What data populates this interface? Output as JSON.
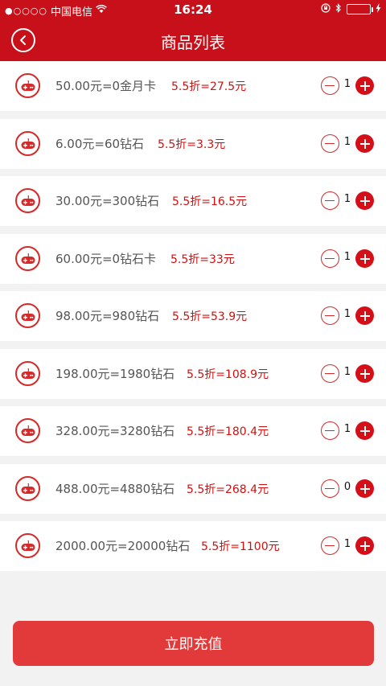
{
  "status_bar": {
    "signal": "●○○○○",
    "carrier": "中国电信",
    "time": "16:24"
  },
  "header": {
    "title": "商品列表"
  },
  "items": [
    {
      "name": "50.00元=0金月卡",
      "price": "5.5折=27.5元",
      "qty": "1"
    },
    {
      "name": "6.00元=60钻石",
      "price": "5.5折=3.3元",
      "qty": "1"
    },
    {
      "name": "30.00元=300钻石",
      "price": "5.5折=16.5元",
      "qty": "1"
    },
    {
      "name": "60.00元=0钻石卡",
      "price": "5.5折=33元",
      "qty": "1"
    },
    {
      "name": "98.00元=980钻石",
      "price": "5.5折=53.9元",
      "qty": "1"
    },
    {
      "name": "198.00元=1980钻石",
      "price": "5.5折=108.9元",
      "qty": "1"
    },
    {
      "name": "328.00元=3280钻石",
      "price": "5.5折=180.4元",
      "qty": "1"
    },
    {
      "name": "488.00元=4880钻石",
      "price": "5.5折=268.4元",
      "qty": "0"
    },
    {
      "name": "2000.00元=20000钻石",
      "price": "5.5折=1100元",
      "qty": "1"
    }
  ],
  "footer": {
    "button_label": "立即充值"
  },
  "icons": {
    "back": "back-icon",
    "item": "gamepad-icon",
    "minus": "minus-icon",
    "plus": "plus-icon"
  },
  "colors": {
    "brand_red": "#c8101a",
    "price_red": "#d01010",
    "button_red": "#e23a3a"
  }
}
